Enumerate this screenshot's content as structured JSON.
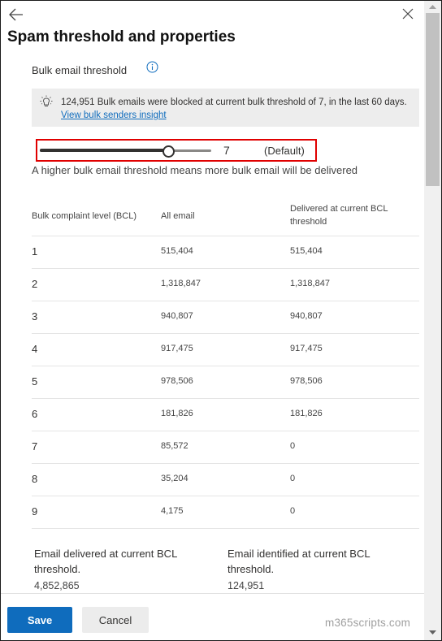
{
  "header": {
    "back_icon": "arrow-left-icon",
    "close_icon": "close-icon",
    "title": "Spam threshold and properties"
  },
  "bulk": {
    "label": "Bulk email threshold",
    "info_icon": "info-icon",
    "notice": {
      "icon": "lightbulb-icon",
      "text": "124,951 Bulk emails were blocked at current bulk threshold of 7, in the last 60 days.",
      "link": "View bulk senders insight"
    },
    "slider": {
      "min": 1,
      "max": 9,
      "value": 7,
      "value_label": "7",
      "default_label": "(Default)"
    },
    "hint": "A higher bulk email threshold means more bulk email will be delivered"
  },
  "table": {
    "headers": [
      "Bulk complaint level (BCL)",
      "All email",
      "Delivered at current BCL threshold"
    ],
    "rows": [
      {
        "level": "1",
        "all": "515,404",
        "delivered": "515,404"
      },
      {
        "level": "2",
        "all": "1,318,847",
        "delivered": "1,318,847"
      },
      {
        "level": "3",
        "all": "940,807",
        "delivered": "940,807"
      },
      {
        "level": "4",
        "all": "917,475",
        "delivered": "917,475"
      },
      {
        "level": "5",
        "all": "978,506",
        "delivered": "978,506"
      },
      {
        "level": "6",
        "all": "181,826",
        "delivered": "181,826"
      },
      {
        "level": "7",
        "all": "85,572",
        "delivered": "0"
      },
      {
        "level": "8",
        "all": "35,204",
        "delivered": "0"
      },
      {
        "level": "9",
        "all": "4,175",
        "delivered": "0"
      }
    ]
  },
  "summary": {
    "delivered_label": "Email delivered at current BCL threshold.",
    "delivered_value": "4,852,865",
    "identified_label": "Email identified at current BCL threshold.",
    "identified_value": "124,951"
  },
  "footer": {
    "save_label": "Save",
    "cancel_label": "Cancel"
  },
  "watermark": "m365scripts.com",
  "colors": {
    "primary": "#0f6cbd",
    "highlight_border": "#e00000",
    "notice_bg": "#ededed"
  }
}
